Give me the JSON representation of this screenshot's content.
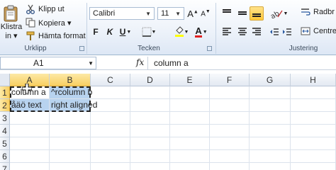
{
  "clipboard": {
    "paste_label": "Klistra\nin",
    "paste_label_line1": "Klistra",
    "paste_label_line2": "in ▾",
    "cut_label": "Klipp ut",
    "copy_label": "Kopiera ▾",
    "format_painter_label": "Hämta format",
    "group_label": "Urklipp"
  },
  "font": {
    "font_name": "Calibri",
    "font_size": "11",
    "bold": "F",
    "italic": "K",
    "underline": "U",
    "group_label": "Tecken"
  },
  "alignment": {
    "wrap_label": "Radbr",
    "center_label": "Centre",
    "group_label": "Justering"
  },
  "formula_bar": {
    "name_box": "A1",
    "fx_label": "fx",
    "formula": "column a"
  },
  "columns": [
    "A",
    "B",
    "C",
    "D",
    "E",
    "F",
    "G",
    "H"
  ],
  "rows": [
    "1",
    "2",
    "3",
    "4",
    "5",
    "6",
    "7"
  ],
  "cells": {
    "a1": "column a",
    "b1": "^rcolumn b",
    "a2": "åäö text",
    "b2": "right aligned"
  },
  "colors": {
    "selection_fill": "#b8d3ef",
    "header_highlight": "#f8cf62",
    "ribbon_bg": "#eef3fa"
  }
}
